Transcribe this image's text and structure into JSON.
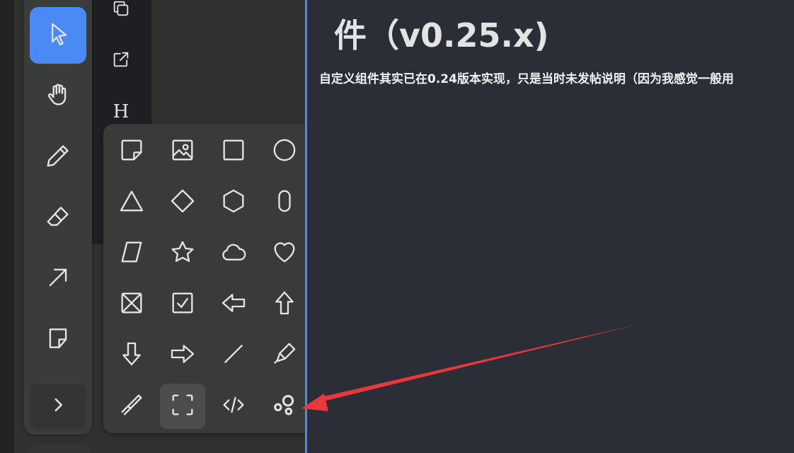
{
  "colors": {
    "accent": "#4a8af4",
    "annotation_arrow": "#e8393a"
  },
  "toolbar": {
    "tools": [
      {
        "icon": "cursor-icon",
        "selected": true
      },
      {
        "icon": "hand-icon"
      },
      {
        "icon": "pencil-icon"
      },
      {
        "icon": "eraser-icon"
      },
      {
        "icon": "arrow-icon"
      },
      {
        "icon": "note-icon"
      },
      {
        "icon": "chevron-right-icon"
      }
    ]
  },
  "side_panel": {
    "items": [
      {
        "icon": "copy-icon"
      },
      {
        "icon": "external-link-icon"
      },
      {
        "icon": "heading-icon",
        "label": "H"
      }
    ]
  },
  "shapes_panel": {
    "rows": [
      [
        "note-icon",
        "image-icon",
        "rectangle-icon",
        "ellipse-icon"
      ],
      [
        "triangle-icon",
        "diamond-icon",
        "hexagon-icon",
        "oval-icon"
      ],
      [
        "trapezoid-icon",
        "star-icon",
        "cloud-icon",
        "heart-icon"
      ],
      [
        "x-box-icon",
        "check-box-icon",
        "arrow-left-icon",
        "arrow-up-icon"
      ],
      [
        "arrow-down-icon",
        "arrow-right-icon",
        "line-icon",
        "highlighter-icon"
      ],
      [
        "laser-icon",
        "frame-icon",
        "embed-icon",
        "custom-shapes-icon"
      ]
    ],
    "hovered": "frame-icon"
  },
  "document": {
    "heading": "件（v0.25.x)",
    "paragraph": "自定义组件其实已在0.24版本实现，只是当时未发帖说明（因为我感觉一般用"
  }
}
